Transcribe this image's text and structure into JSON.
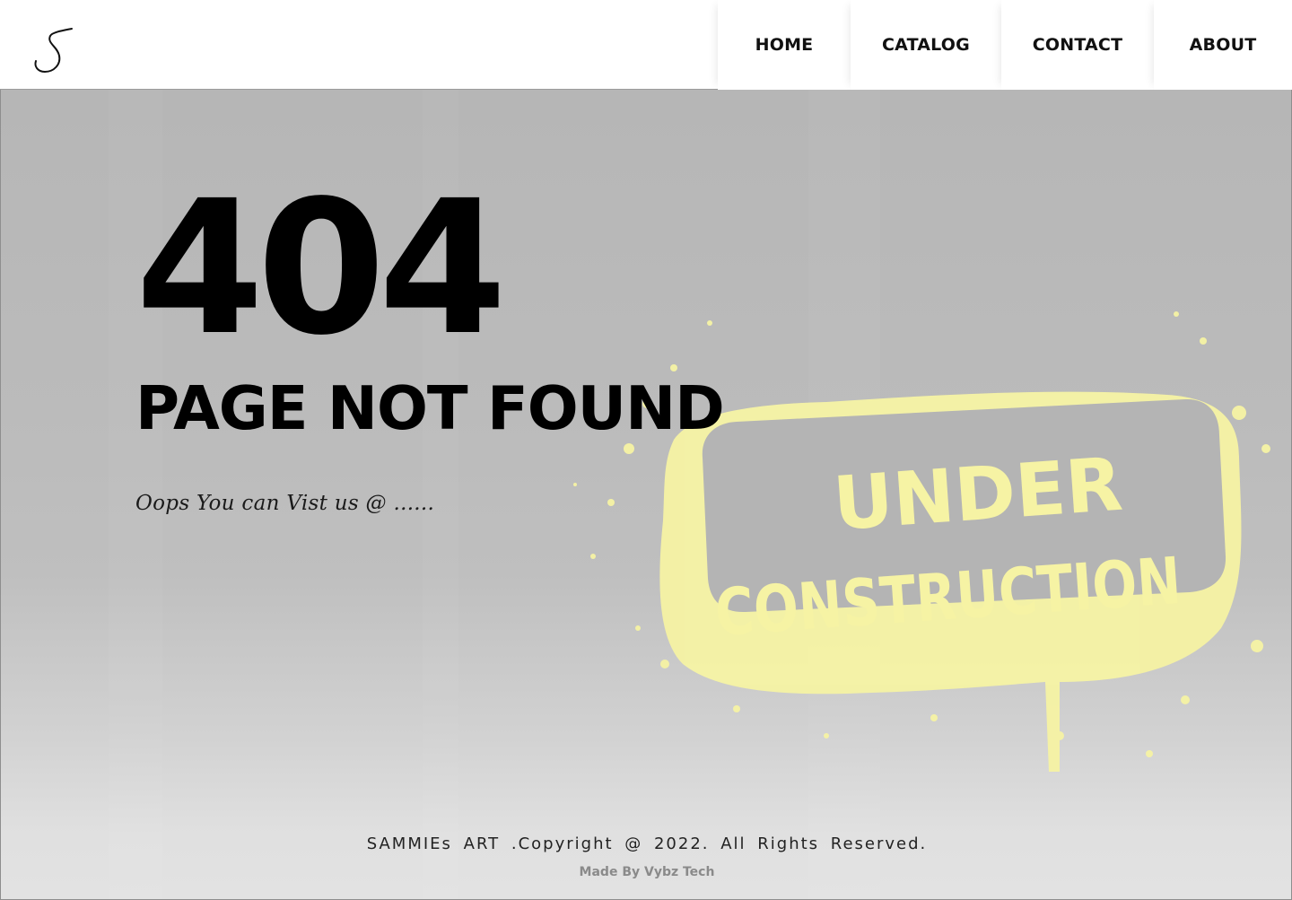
{
  "header": {
    "logo_icon": "script-s-logo",
    "nav": [
      {
        "label": "HOME"
      },
      {
        "label": "CATALOG"
      },
      {
        "label": "CONTACT"
      },
      {
        "label": "ABOUT"
      }
    ]
  },
  "main": {
    "code": "404",
    "headline": "PAGE NOT FOUND",
    "message": "Oops   You can Vist us @ ......",
    "stamp": {
      "line1": "UNDER",
      "line2": "CONSTRUCTION",
      "color": "#f6f3a4"
    }
  },
  "footer": {
    "copyright": "SAMMIEs ART .Copyright @ 2022. All Rights Reserved.",
    "credit": "Made By Vybz Tech"
  }
}
